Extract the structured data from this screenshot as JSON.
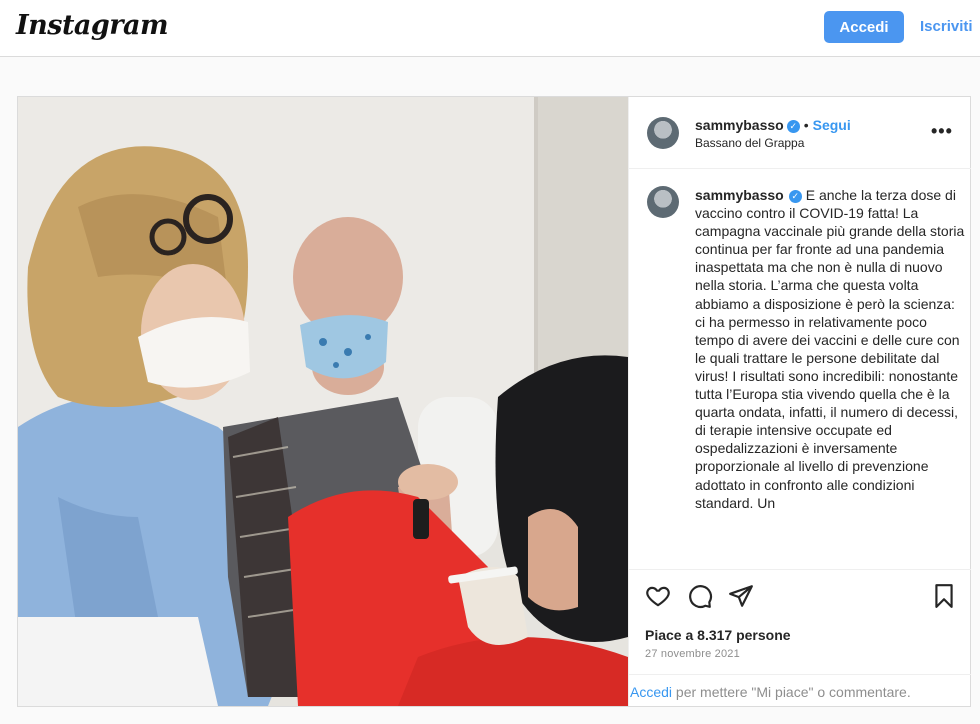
{
  "header": {
    "logo": "Instagram",
    "login_label": "Accedi",
    "signup_label": "Iscriviti"
  },
  "post": {
    "username": "sammybasso",
    "follow_label": "Segui",
    "dot": "•",
    "location": "Bassano del Grappa",
    "more_label": "•••",
    "caption": "E anche la terza dose di vaccino contro il COVID-19 fatta! La campagna vaccinale più grande della storia continua per far fronte ad una pandemia inaspettata ma che non è nulla di nuovo nella storia. L’arma che questa volta abbiamo a disposizione è però la scienza: ci ha permesso in relativamente poco tempo di avere dei vaccini e delle cure con le quali trattare le persone debilitate dal virus! I risultati sono incredibili: nonostante tutta l’Europa stia vivendo quella che è la quarta ondata, infatti, il numero di decessi, di terapie intensive occupate ed ospedalizzazioni è inversamente proporzionale al livello di prevenzione adottato in confronto alle condizioni standard. Un",
    "likes": "Piace a 8.317 persone",
    "date": "27 novembre 2021",
    "login_prompt_link": "Accedi",
    "login_prompt_rest": " per mettere \"Mi piace\" o commentare."
  },
  "icons": {
    "like": "heart-icon",
    "comment": "comment-icon",
    "share": "share-icon",
    "save": "bookmark-icon",
    "verified": "verified-badge-icon"
  },
  "colors": {
    "accent": "#4b96f0",
    "link": "#3897f0",
    "muted": "#8e8e8e"
  }
}
